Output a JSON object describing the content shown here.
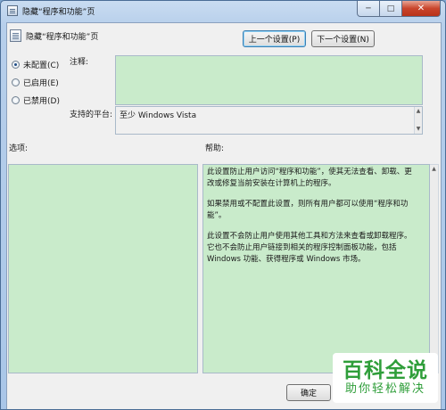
{
  "window": {
    "title": "隐藏“程序和功能”页",
    "minimize_glyph": "─",
    "maximize_glyph": "□",
    "close_glyph": "✕"
  },
  "header": {
    "title": "隐藏“程序和功能”页",
    "prev_button": "上一个设置(P)",
    "next_button": "下一个设置(N)"
  },
  "state": {
    "options": [
      {
        "label": "未配置(C)",
        "checked": true
      },
      {
        "label": "已启用(E)",
        "checked": false
      },
      {
        "label": "已禁用(D)",
        "checked": false
      }
    ]
  },
  "comment": {
    "label": "注释:",
    "value": ""
  },
  "platform": {
    "label": "支持的平台:",
    "value": "至少 Windows Vista"
  },
  "panes": {
    "options_label": "选项:",
    "help_label": "帮助:"
  },
  "help_text": [
    "此设置防止用户访问“程序和功能”，使其无法查看、卸载、更改或修复当前安装在计算机上的程序。",
    "如果禁用或不配置此设置，则所有用户都可以使用“程序和功能”。",
    "此设置不会防止用户使用其他工具和方法来查看或卸载程序。它也不会防止用户链接到相关的程序控制面板功能，包括 Windows 功能、获得程序或 Windows 市场。"
  ],
  "footer": {
    "ok_button": "确定"
  },
  "watermark": {
    "main": "百科全说",
    "sub": "助你轻松解决"
  },
  "colors": {
    "editable_bg": "#c9ebcb",
    "watermark_green": "#2f9e3a"
  }
}
